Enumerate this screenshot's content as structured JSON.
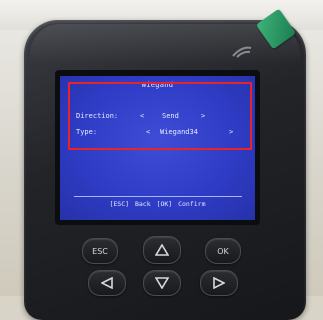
{
  "screen": {
    "title": "Wiegand",
    "direction": {
      "label": "Direction:",
      "arrow_left": "<",
      "value": "Send",
      "arrow_right": ">"
    },
    "type": {
      "label": "Type:",
      "arrow_left": "<",
      "value": "Wiegand34",
      "arrow_right": ">"
    },
    "footer": "[ESC] Back  [OK] Confirm"
  },
  "keypad": {
    "esc_label": "ESC",
    "ok_label": "OK",
    "up_icon": "triangle-up-icon",
    "down_icon": "triangle-down-icon",
    "left_icon": "triangle-left-icon",
    "right_icon": "triangle-right-icon"
  },
  "colors": {
    "screen_bg": "#2f3cc6",
    "highlight": "#e8242a",
    "led": "#2a9a63"
  }
}
